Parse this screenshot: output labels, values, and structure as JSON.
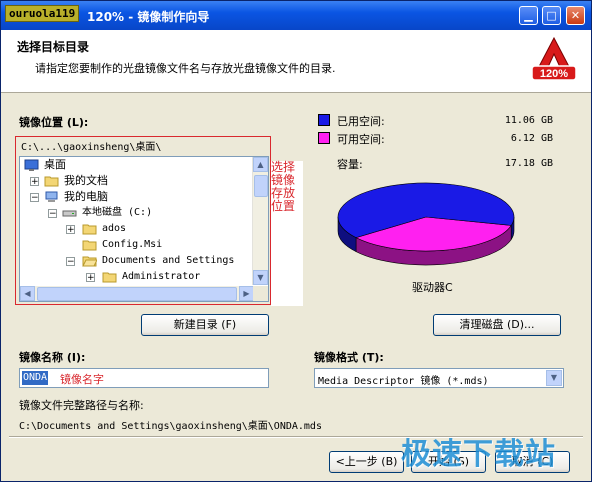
{
  "titlebar": {
    "badge": "ouruola119",
    "title": "120% - 镜像制作向导",
    "title_prefix_partial": "1"
  },
  "header": {
    "title": "选择目标目录",
    "description": "请指定您要制作的光盘镜像文件名与存放光盘镜像文件的目录.",
    "logo_text": "120%"
  },
  "location": {
    "label": "镜像位置 (L):",
    "path": "C:\\...\\gaoxinsheng\\桌面\\"
  },
  "tree": {
    "items": [
      {
        "label": "桌面"
      },
      {
        "label": "我的文档"
      },
      {
        "label": "我的电脑"
      },
      {
        "label": "本地磁盘 (C:)"
      },
      {
        "label": "ados"
      },
      {
        "label": "Config.Msi"
      },
      {
        "label": "Documents and Settings"
      },
      {
        "label": "Administrator"
      }
    ]
  },
  "annotation": "选择镜像存放位置",
  "disk": {
    "used_label": "已用空间:",
    "used_value": "11.06 GB",
    "free_label": "可用空间:",
    "free_value": "6.12 GB",
    "capacity_label": "容量:",
    "capacity_value": "17.18 GB",
    "drive_label": "驱动器C",
    "used_color": "#1a1ae6",
    "free_color": "#ff20f0"
  },
  "buttons": {
    "new_folder": "新建目录 (F)",
    "clean_disk": "清理磁盘 (D)...",
    "back": "<上一步 (B)",
    "start": "开始 (S)",
    "cancel": "取消 (C)"
  },
  "image_name": {
    "label": "镜像名称 (I):",
    "value": "ONDA",
    "hint": "镜像名字"
  },
  "image_format": {
    "label": "镜像格式 (T):",
    "value": "Media Descriptor 镜像 (*.mds)"
  },
  "full_path": {
    "label": "镜像文件完整路径与名称:",
    "value": "C:\\Documents and Settings\\gaoxinsheng\\桌面\\ONDA.mds"
  },
  "watermark": "极速下载站"
}
